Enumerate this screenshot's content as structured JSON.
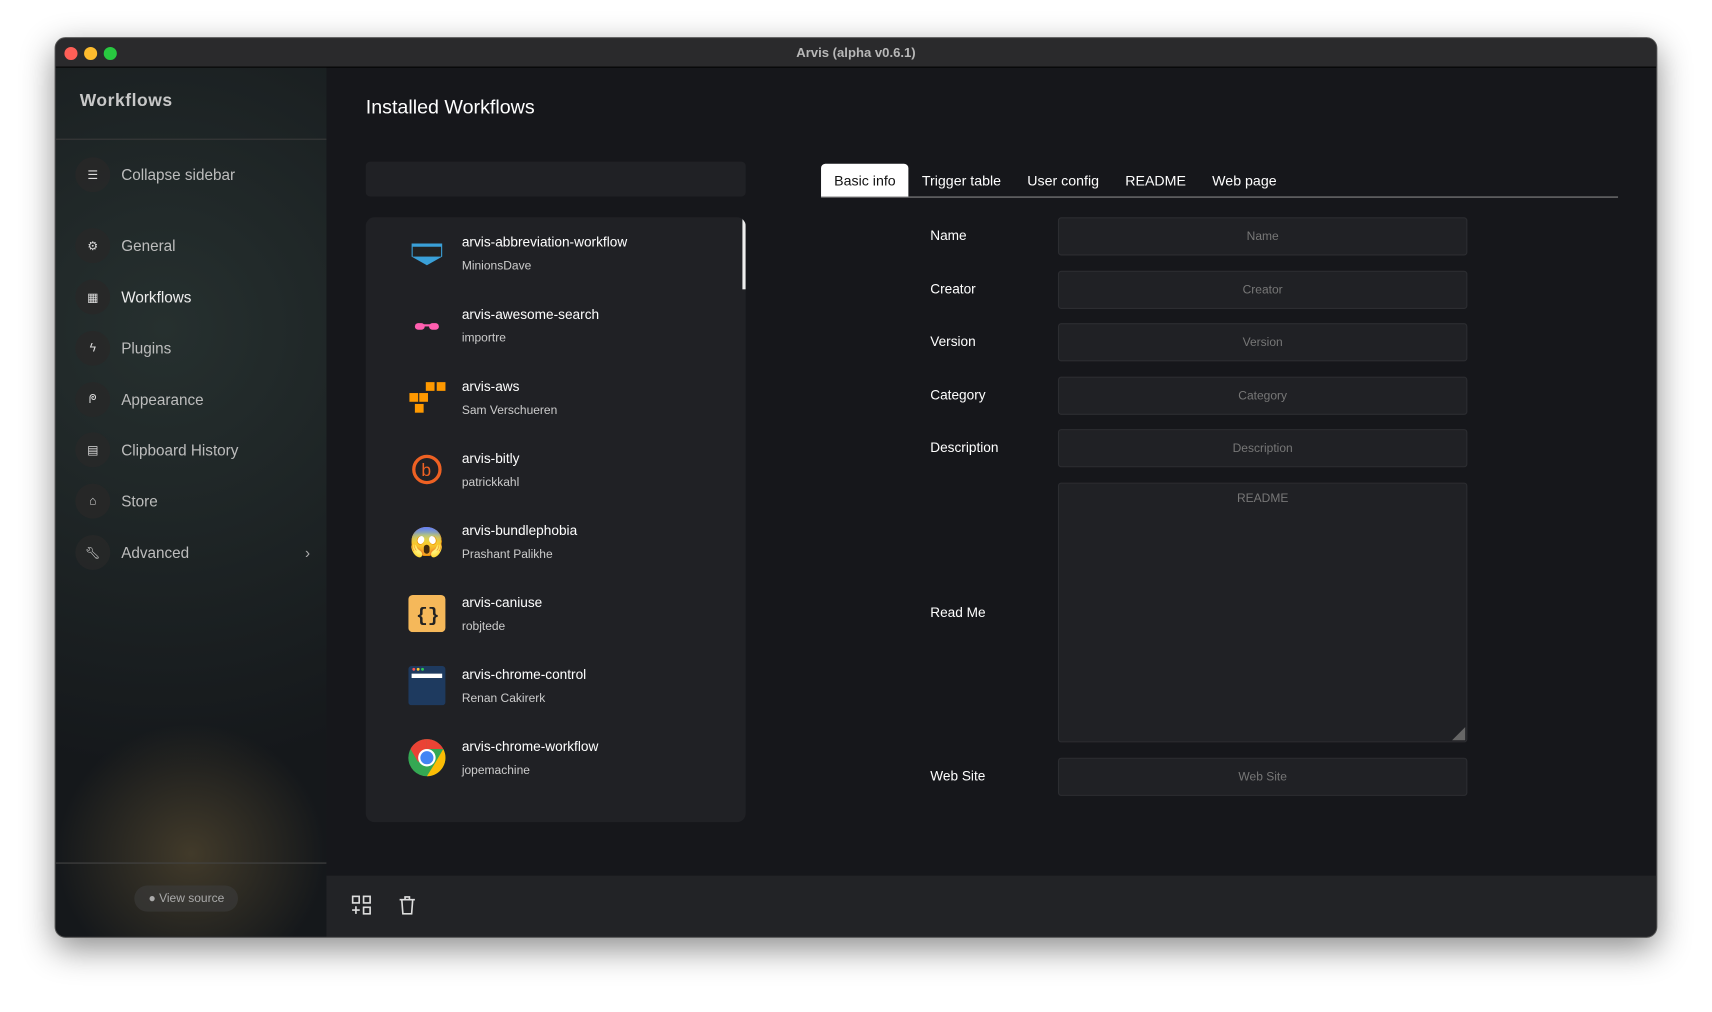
{
  "window": {
    "title": "Arvis (alpha v0.6.1)"
  },
  "sidebar": {
    "title": "Workflows",
    "items": [
      {
        "label": "Collapse sidebar",
        "icon": "sort-icon"
      },
      {
        "label": "General",
        "icon": "gear-icon"
      },
      {
        "label": "Workflows",
        "icon": "grid-icon"
      },
      {
        "label": "Plugins",
        "icon": "bolt-icon"
      },
      {
        "label": "Appearance",
        "icon": "paint-roller-icon"
      },
      {
        "label": "Clipboard History",
        "icon": "clipboard-icon"
      },
      {
        "label": "Store",
        "icon": "store-icon"
      },
      {
        "label": "Advanced",
        "icon": "wrench-icon"
      }
    ],
    "view_source": "View source"
  },
  "main": {
    "title": "Installed Workflows",
    "search": {
      "value": "",
      "placeholder": ""
    },
    "workflows": [
      {
        "name": "arvis-abbreviation-workflow",
        "author": "MinionsDave"
      },
      {
        "name": "arvis-awesome-search",
        "author": "importre"
      },
      {
        "name": "arvis-aws",
        "author": "Sam Verschueren"
      },
      {
        "name": "arvis-bitly",
        "author": "patrickkahl"
      },
      {
        "name": "arvis-bundlephobia",
        "author": "Prashant Palikhe"
      },
      {
        "name": "arvis-caniuse",
        "author": "robjtede"
      },
      {
        "name": "arvis-chrome-control",
        "author": "Renan Cakirerk"
      },
      {
        "name": "arvis-chrome-workflow",
        "author": "jopemachine"
      }
    ],
    "tabs": [
      "Basic info",
      "Trigger table",
      "User config",
      "README",
      "Web page"
    ],
    "form": {
      "name": {
        "label": "Name",
        "placeholder": "Name"
      },
      "creator": {
        "label": "Creator",
        "placeholder": "Creator"
      },
      "version": {
        "label": "Version",
        "placeholder": "Version"
      },
      "category": {
        "label": "Category",
        "placeholder": "Category"
      },
      "description": {
        "label": "Description",
        "placeholder": "Description"
      },
      "readme": {
        "label": "Read Me",
        "placeholder": "README"
      },
      "website": {
        "label": "Web Site",
        "placeholder": "Web Site"
      }
    }
  }
}
